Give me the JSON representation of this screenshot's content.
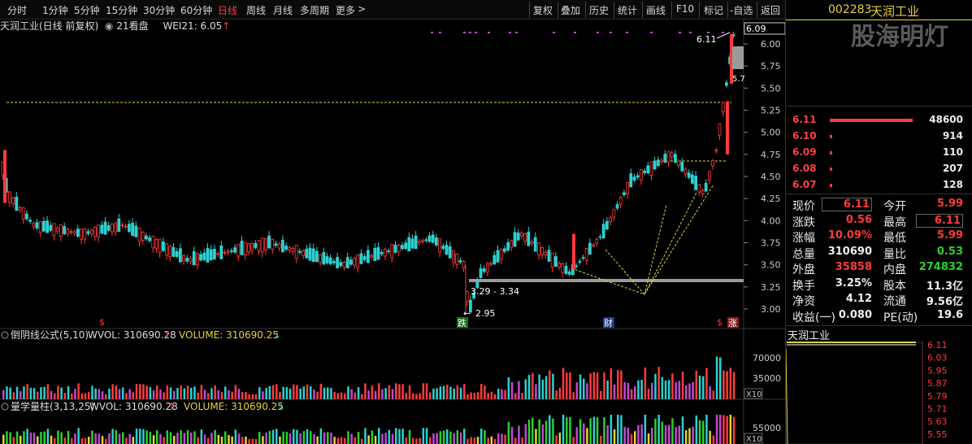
{
  "toolbar": {
    "periods": [
      "分时",
      "1分钟",
      "5分钟",
      "15分钟",
      "30分钟",
      "60分钟",
      "日线",
      "周线",
      "月线",
      "多周期",
      "更多"
    ],
    "more_arrow": ">",
    "actions": [
      "复权",
      "叠加",
      "历史",
      "统计",
      "画线",
      "F10",
      "标记",
      "-自选",
      "返回"
    ]
  },
  "chart_header": {
    "title": "天润工业(日线 前复权)",
    "pattern_label": "21看盘",
    "indicator": "WEI21: 6.05",
    "indicator_arrow": "↑"
  },
  "price_axis": [
    "6.00",
    "5.75",
    "5.50",
    "5.25",
    "5.00",
    "4.75",
    "4.50",
    "4.25",
    "4.00",
    "3.75",
    "3.50",
    "3.25",
    "3.00"
  ],
  "price_tag_top": "6.09",
  "annotations": {
    "high_label": "6.11",
    "range_label": "3.29 - 3.34",
    "low_label": "2.95",
    "arrow": "←",
    "badge_drop": "跌",
    "badge_fortune": "财",
    "badge_rise": "涨",
    "badge_s": "$",
    "badge_s2": "$",
    "cut_label": "5.7"
  },
  "vol1": {
    "name": "倒阴线公式(5,10)",
    "wvol": "WVOL: 310690.28",
    "volume": "VOLUME: 310690.25",
    "up": "↑",
    "down": "↓",
    "axis": [
      "70000",
      "35000"
    ],
    "scale": "X10"
  },
  "vol2": {
    "name": "量学量柱(3,13,25)",
    "wvol": "WVOL: 310690.28",
    "volume": "VOLUME: 310690.25",
    "up": "↑",
    "down": "↓",
    "axis": [
      "55000"
    ],
    "scale": "X10"
  },
  "quote": {
    "code": "002283",
    "name": "天润工业",
    "watermark": "股海明灯",
    "orderbook": [
      {
        "price": "6.11",
        "vol": "48600"
      },
      {
        "price": "6.10",
        "vol": "914"
      },
      {
        "price": "6.09",
        "vol": "110"
      },
      {
        "price": "6.08",
        "vol": "207"
      },
      {
        "price": "6.07",
        "vol": "128"
      }
    ],
    "rows": [
      {
        "l1": "现价",
        "v1": "6.11",
        "l2": "今开",
        "v2": "5.99"
      },
      {
        "l1": "涨跌",
        "v1": "0.56",
        "l2": "最高",
        "v2": "6.11"
      },
      {
        "l1": "涨幅",
        "v1": "10.09%",
        "l2": "最低",
        "v2": "5.99"
      },
      {
        "l1": "总量",
        "v1": "310690",
        "l2": "量比",
        "v2": "0.53"
      },
      {
        "l1": "外盘",
        "v1": "35858",
        "l2": "内盘",
        "v2": "274832"
      },
      {
        "l1": "换手",
        "v1": "3.25%",
        "l2": "股本",
        "v2": "11.3亿"
      },
      {
        "l1": "净资",
        "v1": "4.12",
        "l2": "流通",
        "v2": "9.56亿"
      },
      {
        "l1": "收益(一)",
        "v1": "0.080",
        "l2": "PE(动)",
        "v2": "19.6"
      }
    ]
  },
  "mini_chart": {
    "title": "天润工业",
    "axis": [
      "6.11",
      "6.03",
      "5.95",
      "5.87",
      "5.79",
      "5.71",
      "5.63",
      "5.55"
    ]
  }
}
